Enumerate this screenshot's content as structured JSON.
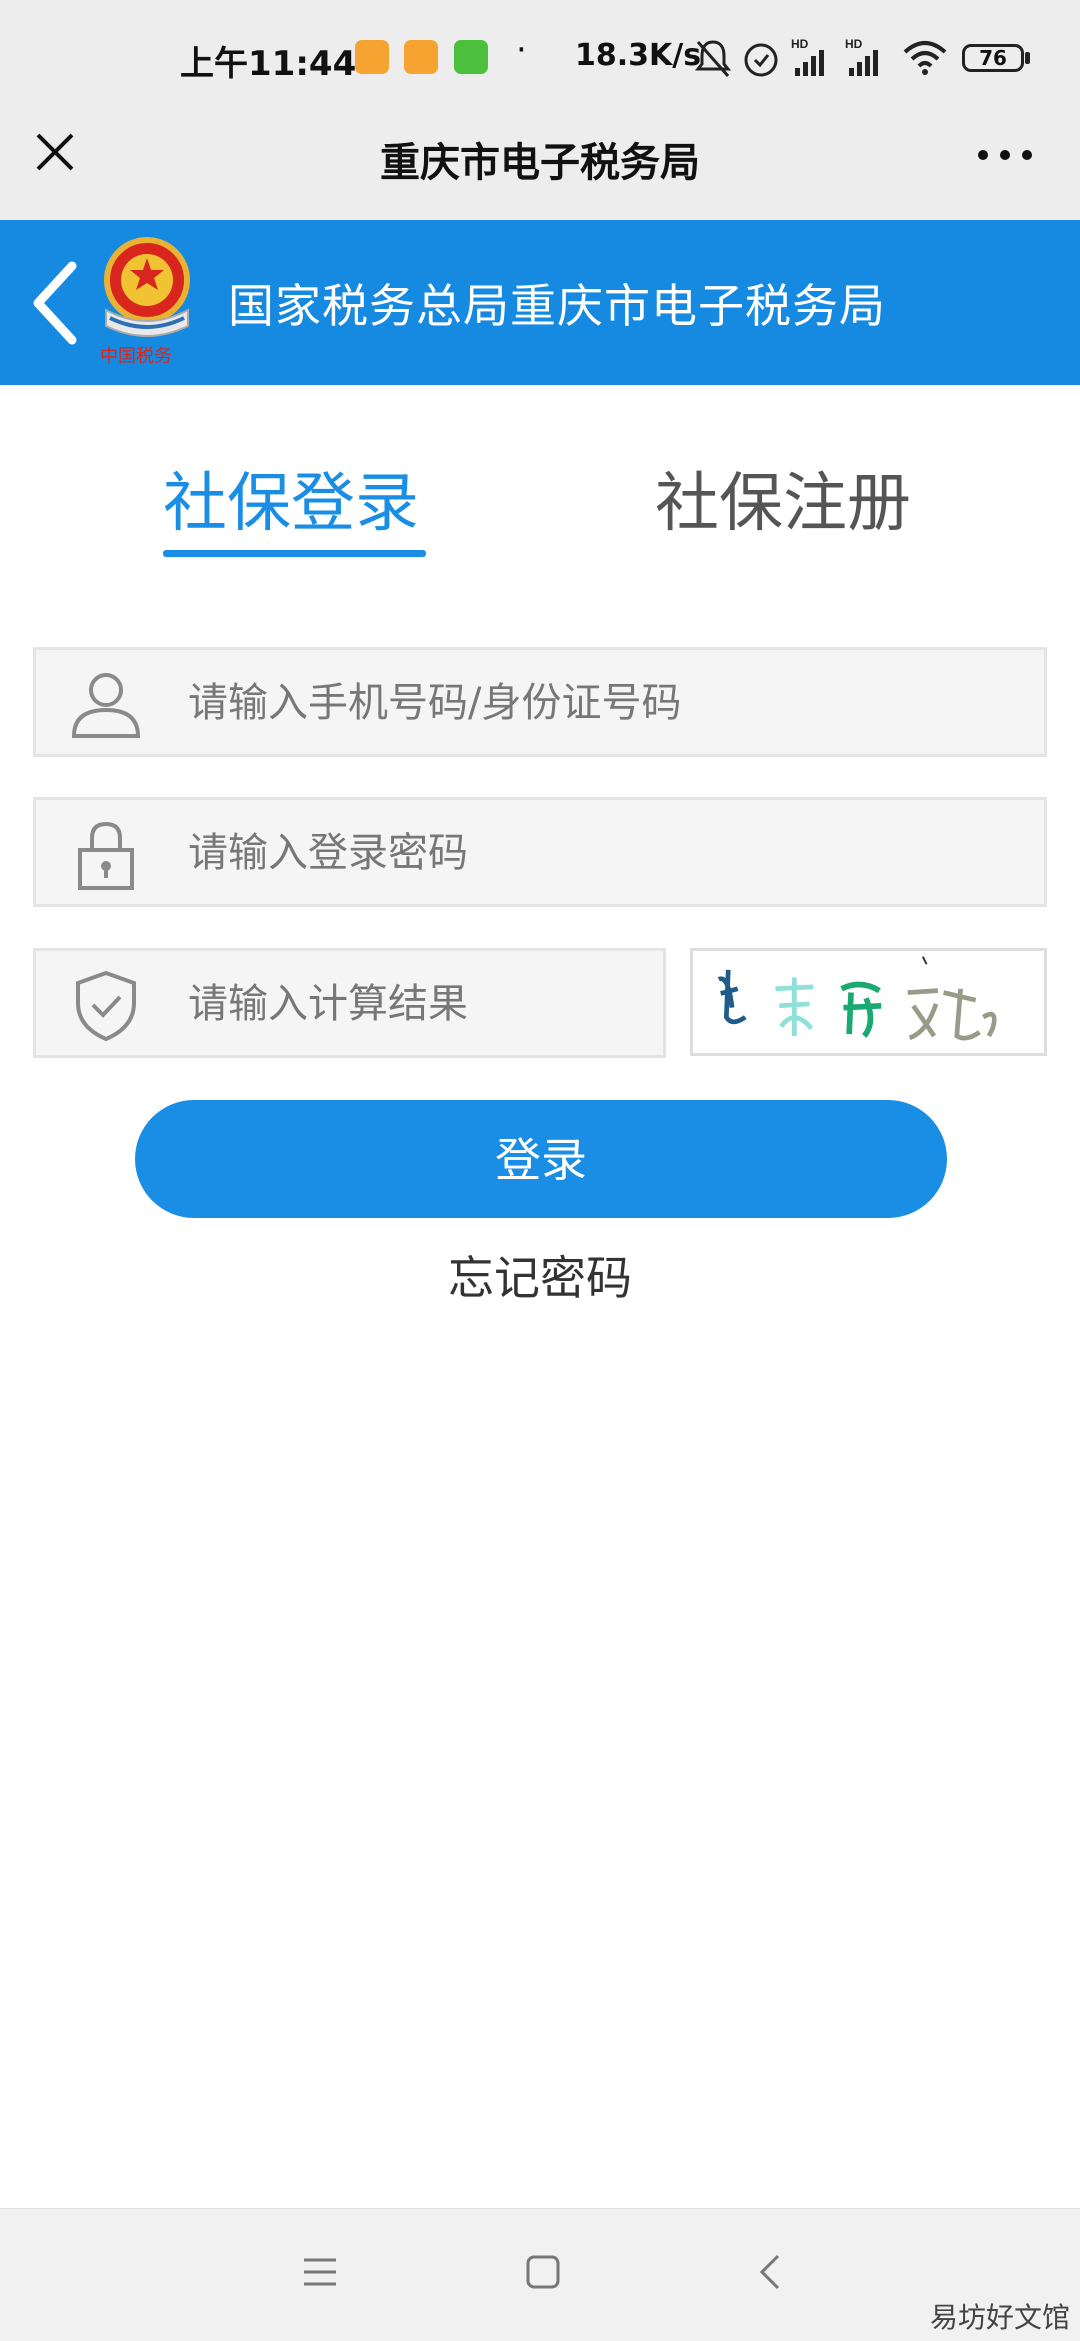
{
  "status_bar": {
    "time": "上午11:44",
    "dot": "·",
    "net_speed": "18.3K/s",
    "battery": "76",
    "icons": [
      "notes-app-icon",
      "notes-app-icon",
      "wechat-mini-icon",
      "mute-bell-icon",
      "alarm-icon",
      "hd-signal-icon",
      "hd-signal-icon",
      "wifi-icon",
      "battery-icon"
    ]
  },
  "titlebar": {
    "title": "重庆市电子税务局"
  },
  "header": {
    "title": "国家税务总局重庆市电子税务局",
    "emblem_caption": "中国税务",
    "bg_color": "#1689e0"
  },
  "tabs": [
    {
      "label": "社保登录",
      "active": true
    },
    {
      "label": "社保注册",
      "active": false
    }
  ],
  "form": {
    "account_placeholder": "请输入手机号码/身份证号码",
    "password_placeholder": "请输入登录密码",
    "captcha_placeholder": "请输入计算结果",
    "login_label": "登录",
    "forgot_label": "忘记密码"
  },
  "watermark": "易坊好文馆",
  "colors": {
    "accent": "#1a8ee4",
    "titlebar": "#ededed"
  }
}
